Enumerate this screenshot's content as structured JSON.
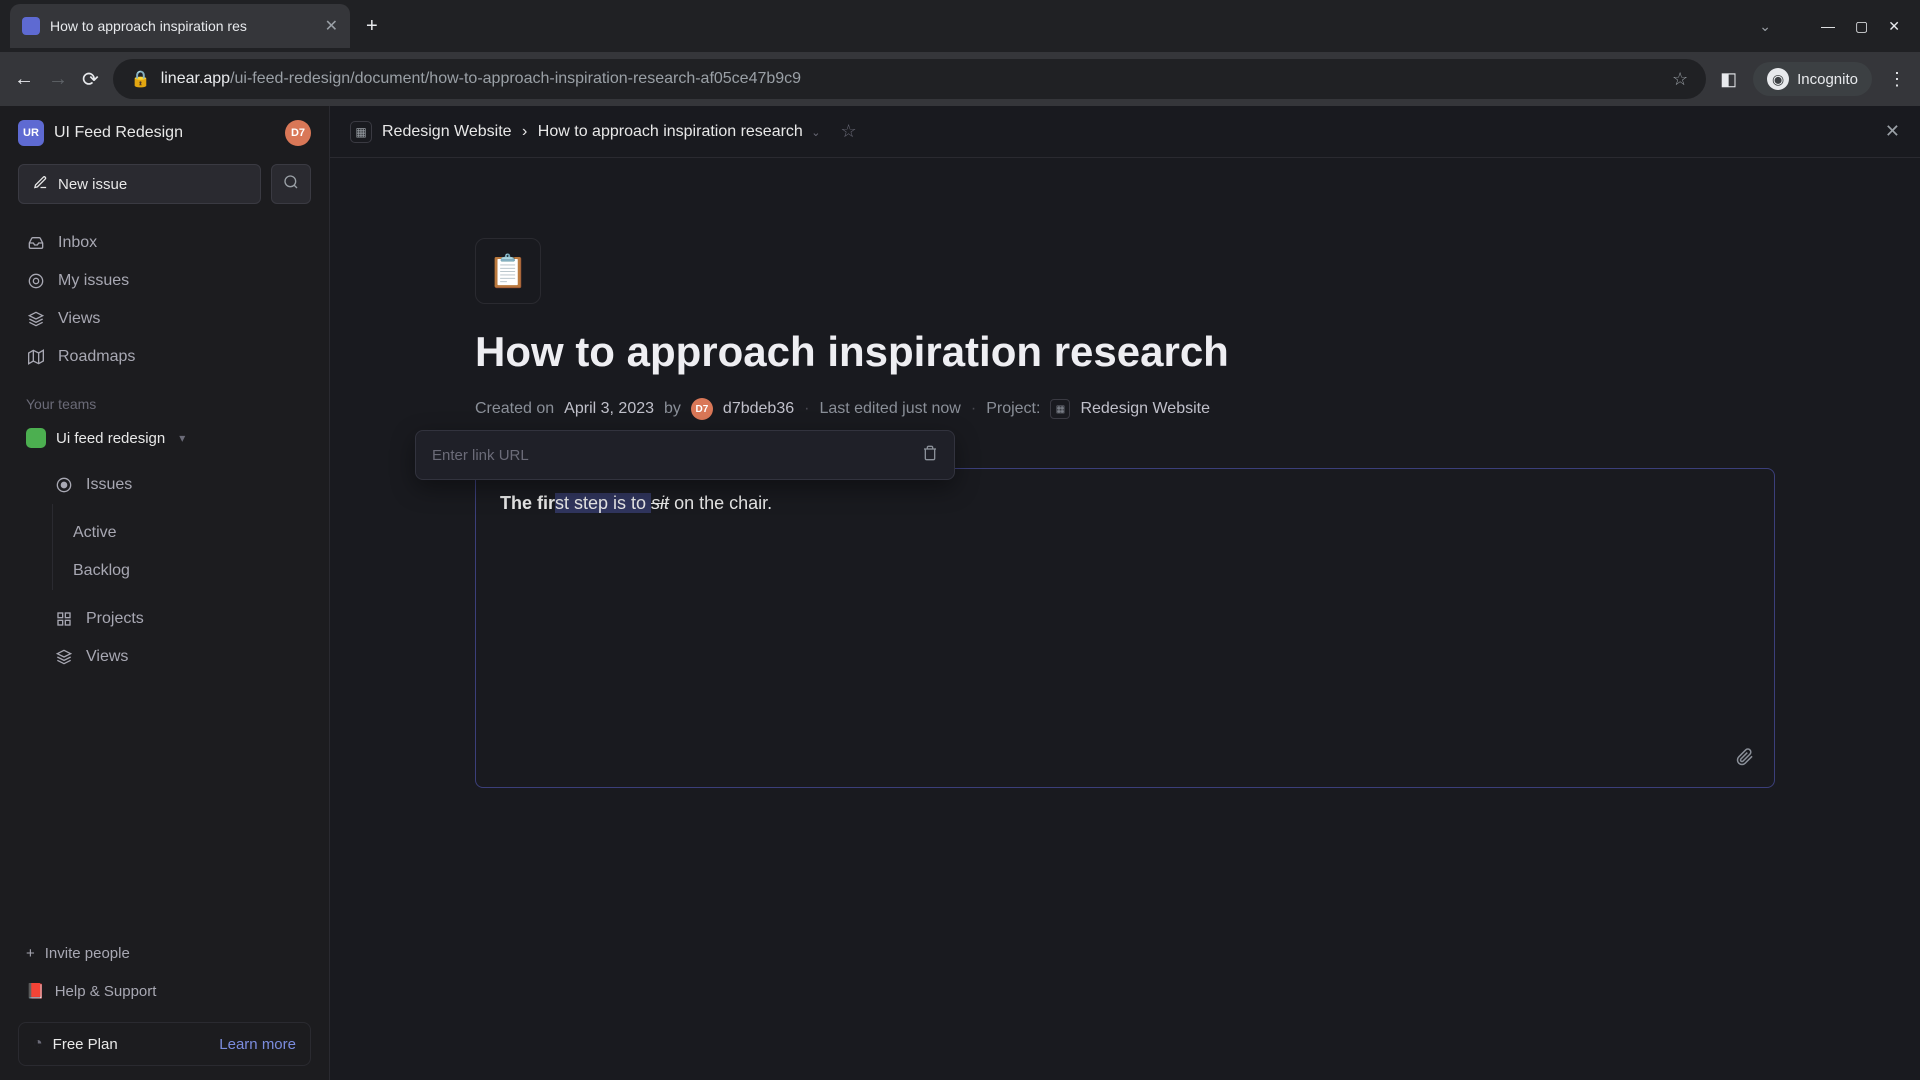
{
  "browser": {
    "tab_title": "How to approach inspiration res",
    "url_host": "linear.app",
    "url_path": "/ui-feed-redesign/document/how-to-approach-inspiration-research-af05ce47b9c9",
    "incognito_label": "Incognito"
  },
  "workspace": {
    "badge": "UR",
    "name": "UI Feed Redesign",
    "user_badge": "D7"
  },
  "sidebar": {
    "new_issue": "New issue",
    "nav": {
      "inbox": "Inbox",
      "my_issues": "My issues",
      "views": "Views",
      "roadmaps": "Roadmaps"
    },
    "teams_label": "Your teams",
    "team": {
      "name": "Ui feed redesign",
      "items": {
        "issues": "Issues",
        "active": "Active",
        "backlog": "Backlog",
        "projects": "Projects",
        "views": "Views"
      }
    },
    "footer": {
      "invite": "Invite people",
      "help": "Help & Support",
      "plan": "Free Plan",
      "learn": "Learn more"
    }
  },
  "doc": {
    "breadcrumb_project": "Redesign Website",
    "breadcrumb_sep": "›",
    "breadcrumb_title": "How to approach inspiration research",
    "emoji": "📋",
    "title": "How to approach inspiration research",
    "meta": {
      "created_prefix": "Created on",
      "created_date": "April 3, 2023",
      "by": "by",
      "author": "d7bdeb36",
      "author_badge": "D7",
      "edited": "Last edited just now",
      "project_label": "Project:",
      "project_name": "Redesign Website"
    },
    "link_popup": {
      "placeholder": "Enter link URL"
    },
    "editor": {
      "bold_part": "The fir",
      "sel_part": "st step is to ",
      "italic_part": "sit",
      "rest_part": " on the chair."
    }
  }
}
